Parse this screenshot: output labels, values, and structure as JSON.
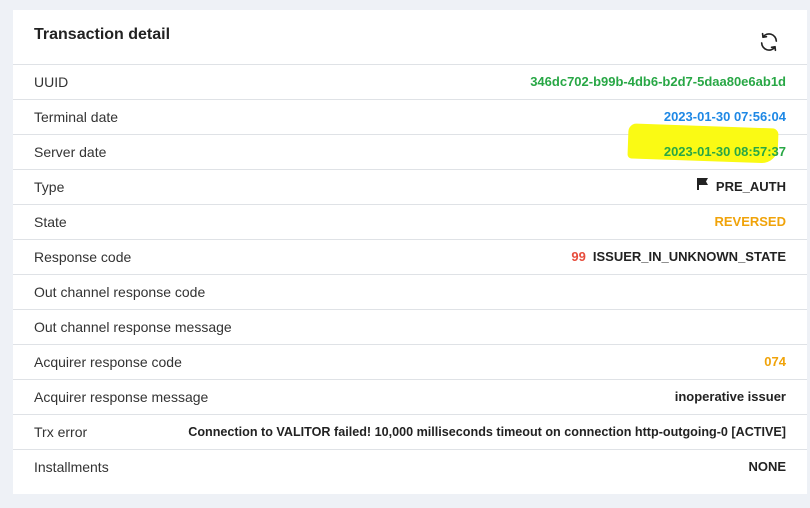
{
  "card": {
    "title": "Transaction detail"
  },
  "rows": [
    {
      "label": "UUID",
      "value": "346dc702-b99b-4db6-b2d7-5daa80e6ab1d"
    },
    {
      "label": "Terminal date",
      "value": "2023-01-30 07:56:04"
    },
    {
      "label": "Server date",
      "value": "2023-01-30 08:57:37"
    },
    {
      "label": "Type",
      "value": "PRE_AUTH"
    },
    {
      "label": "State",
      "value": "REVERSED"
    },
    {
      "label": "Response code",
      "code": "99",
      "value": "ISSUER_IN_UNKNOWN_STATE"
    },
    {
      "label": "Out channel response code",
      "value": ""
    },
    {
      "label": "Out channel response message",
      "value": ""
    },
    {
      "label": "Acquirer response code",
      "value": "074"
    },
    {
      "label": "Acquirer response message",
      "value": "inoperative issuer"
    },
    {
      "label": "Trx error",
      "value": "Connection to VALITOR failed! 10,000 milliseconds timeout on connection http-outgoing-0 [ACTIVE]"
    },
    {
      "label": "Installments",
      "value": "NONE"
    }
  ],
  "colors": {
    "uuid": "#28a745",
    "terminal_date": "#1e88e5",
    "server_date": "#28a745",
    "state": "#f0a30a",
    "response_code_number": "#e74c3c",
    "acquirer_code": "#f0a30a",
    "highlight": "#fafa14"
  },
  "icons": {
    "refresh": "refresh-icon",
    "type": "flag-icon"
  }
}
